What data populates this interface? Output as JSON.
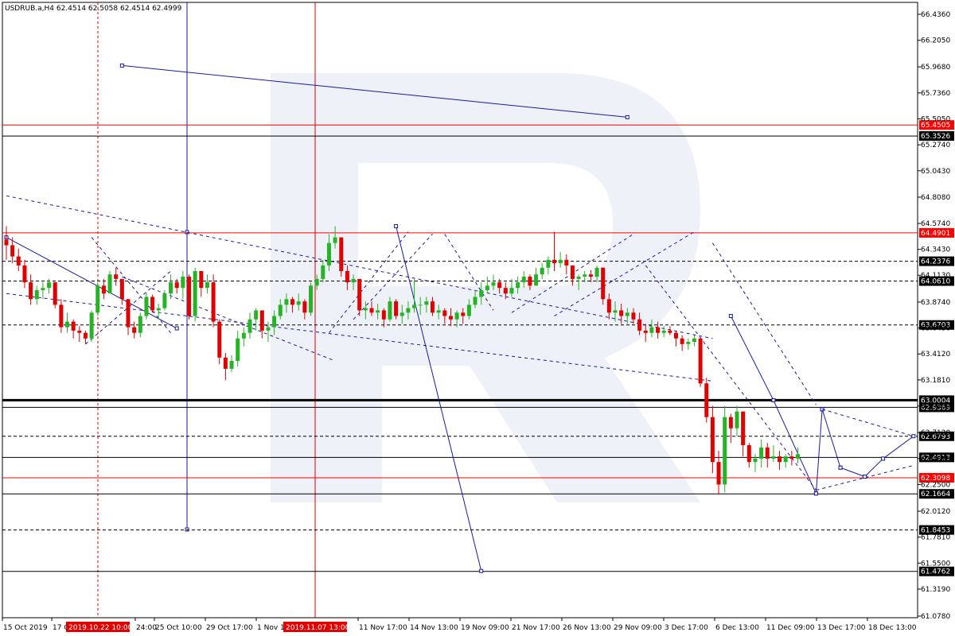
{
  "header": {
    "text": "USDRUB.a,H4  62.4514 62.5058 62.4514 62.4999"
  },
  "chart_data": {
    "type": "candlestick",
    "symbol": "USDRUB.a",
    "timeframe": "H4",
    "ohlc_header": {
      "open": 62.4514,
      "high": 62.5058,
      "low": 62.4514,
      "close": 62.4999
    },
    "ylim": [
      61.078,
      66.436
    ],
    "y_ticks": [
      "66.4360",
      "66.2050",
      "65.9680",
      "65.7360",
      "65.5050",
      "65.2740",
      "65.0430",
      "64.8080",
      "64.5740",
      "64.3430",
      "64.1130",
      "63.8740",
      "63.6430",
      "63.4120",
      "63.1810",
      "62.9480",
      "62.7120",
      "62.4810",
      "62.2500",
      "62.0120",
      "61.7810",
      "61.5500",
      "61.3190",
      "61.0780"
    ],
    "x_ticks": [
      "15 Oct 2019",
      "17 O",
      "24:00",
      "25 Oct 10:00",
      "29 Oct 17:00",
      "1 Nov 1",
      "11 Nov 17:00",
      "14 Nov 13:00",
      "19 Nov 09:00",
      "21 Nov 17:00",
      "26 Nov 13:00",
      "29 Nov 09:00",
      "3 Dec 17:00",
      "6 Dec 13:00",
      "11 Dec 09:00",
      "13 Dec 17:00",
      "18 Dec 13:00"
    ],
    "time_highlights": [
      "2019.10.22 10:00",
      "2019.11.07 13:00"
    ],
    "price_levels": [
      {
        "value": 65.4505,
        "label": "65.4505",
        "style": "solid",
        "color": "#ff0000",
        "highlight": true
      },
      {
        "value": 65.3526,
        "label": "65.3526",
        "style": "solid",
        "color": "#000000",
        "highlight": false
      },
      {
        "value": 64.4901,
        "label": "64.4901",
        "style": "solid",
        "color": "#ff0000",
        "highlight": true
      },
      {
        "value": 64.2376,
        "label": "64.2376",
        "style": "dashed",
        "color": "#000000",
        "highlight": false
      },
      {
        "value": 64.061,
        "label": "64.0610",
        "style": "dashed",
        "color": "#000000",
        "highlight": false
      },
      {
        "value": 63.6703,
        "label": "63.6703",
        "style": "dashed",
        "color": "#000000",
        "highlight": false
      },
      {
        "value": 63.0004,
        "label": "63.0004",
        "style": "thick",
        "color": "#000000",
        "highlight": false
      },
      {
        "value": 62.9369,
        "label": "62.9369",
        "style": "solid",
        "color": "#000000",
        "highlight": false
      },
      {
        "value": 62.6793,
        "label": "62.6793",
        "style": "dashed",
        "color": "#000000",
        "highlight": false
      },
      {
        "value": 62.4913,
        "label": "62.4913",
        "style": "solid",
        "color": "#000000",
        "highlight": false
      },
      {
        "value": 62.3098,
        "label": "62.3098",
        "style": "solid",
        "color": "#ff0000",
        "highlight": true
      },
      {
        "value": 62.1664,
        "label": "62.1664",
        "style": "solid",
        "color": "#000000",
        "highlight": false
      },
      {
        "value": 61.8453,
        "label": "61.8453",
        "style": "dashed",
        "color": "#000000",
        "highlight": false
      },
      {
        "value": 61.4762,
        "label": "61.4762",
        "style": "solid",
        "color": "#000000",
        "highlight": false
      }
    ],
    "candles_hlc": [
      [
        64.55,
        64.25,
        64.38
      ],
      [
        64.45,
        64.22,
        64.28
      ],
      [
        64.35,
        64.15,
        64.2
      ],
      [
        64.25,
        64.0,
        64.05
      ],
      [
        64.12,
        63.85,
        63.9
      ],
      [
        64.02,
        63.85,
        63.98
      ],
      [
        64.05,
        63.9,
        64.0
      ],
      [
        64.08,
        63.95,
        64.05
      ],
      [
        64.0,
        63.82,
        63.85
      ],
      [
        63.9,
        63.6,
        63.65
      ],
      [
        63.78,
        63.6,
        63.7
      ],
      [
        63.72,
        63.55,
        63.62
      ],
      [
        63.66,
        63.52,
        63.6
      ],
      [
        63.62,
        63.5,
        63.55
      ],
      [
        63.8,
        63.52,
        63.78
      ],
      [
        64.05,
        63.75,
        64.02
      ],
      [
        64.08,
        63.9,
        63.95
      ],
      [
        64.15,
        63.95,
        64.12
      ],
      [
        64.18,
        64.02,
        64.08
      ],
      [
        64.05,
        63.85,
        63.9
      ],
      [
        63.9,
        63.58,
        63.65
      ],
      [
        63.7,
        63.55,
        63.6
      ],
      [
        63.78,
        63.56,
        63.75
      ],
      [
        63.96,
        63.72,
        63.92
      ],
      [
        63.94,
        63.78,
        63.8
      ],
      [
        63.86,
        63.72,
        63.82
      ],
      [
        63.98,
        63.8,
        63.95
      ],
      [
        64.12,
        63.9,
        64.05
      ],
      [
        64.08,
        63.95,
        64.0
      ],
      [
        64.15,
        63.9,
        64.1
      ],
      [
        64.12,
        63.72,
        63.75
      ],
      [
        64.18,
        63.7,
        64.15
      ],
      [
        64.15,
        63.92,
        64.0
      ],
      [
        64.12,
        63.95,
        64.05
      ],
      [
        64.12,
        63.65,
        63.7
      ],
      [
        63.72,
        63.32,
        63.38
      ],
      [
        63.42,
        63.18,
        63.28
      ],
      [
        63.4,
        63.25,
        63.35
      ],
      [
        63.62,
        63.3,
        63.55
      ],
      [
        63.65,
        63.48,
        63.6
      ],
      [
        63.78,
        63.55,
        63.72
      ],
      [
        63.82,
        63.62,
        63.8
      ],
      [
        63.75,
        63.55,
        63.62
      ],
      [
        63.7,
        63.52,
        63.65
      ],
      [
        63.8,
        63.58,
        63.75
      ],
      [
        63.9,
        63.72,
        63.85
      ],
      [
        63.95,
        63.78,
        63.9
      ],
      [
        63.92,
        63.78,
        63.85
      ],
      [
        63.95,
        63.8,
        63.88
      ],
      [
        63.9,
        63.72,
        63.78
      ],
      [
        64.05,
        63.75,
        64.02
      ],
      [
        64.12,
        63.98,
        64.08
      ],
      [
        64.25,
        64.05,
        64.2
      ],
      [
        64.48,
        64.15,
        64.4
      ],
      [
        64.55,
        64.35,
        64.45
      ],
      [
        64.42,
        64.1,
        64.15
      ],
      [
        64.2,
        63.98,
        64.05
      ],
      [
        64.12,
        63.98,
        64.08
      ],
      [
        64.05,
        63.75,
        63.8
      ],
      [
        63.88,
        63.72,
        63.82
      ],
      [
        63.88,
        63.75,
        63.78
      ],
      [
        63.86,
        63.72,
        63.8
      ],
      [
        63.82,
        63.65,
        63.72
      ],
      [
        63.92,
        63.7,
        63.88
      ],
      [
        63.9,
        63.72,
        63.75
      ],
      [
        63.85,
        63.68,
        63.78
      ],
      [
        63.88,
        63.72,
        63.82
      ],
      [
        64.08,
        63.78,
        63.85
      ],
      [
        63.92,
        63.76,
        63.85
      ],
      [
        63.92,
        63.78,
        63.88
      ],
      [
        63.92,
        63.75,
        63.78
      ],
      [
        63.85,
        63.72,
        63.8
      ],
      [
        63.82,
        63.68,
        63.75
      ],
      [
        63.82,
        63.66,
        63.72
      ],
      [
        63.8,
        63.65,
        63.78
      ],
      [
        63.82,
        63.68,
        63.75
      ],
      [
        63.9,
        63.72,
        63.85
      ],
      [
        63.98,
        63.82,
        63.92
      ],
      [
        64.05,
        63.85,
        63.98
      ],
      [
        64.1,
        63.95,
        64.02
      ],
      [
        64.12,
        63.98,
        64.05
      ],
      [
        64.08,
        63.95,
        64.0
      ],
      [
        64.05,
        63.9,
        63.95
      ],
      [
        64.08,
        63.92,
        64.0
      ],
      [
        64.1,
        63.95,
        64.05
      ],
      [
        64.15,
        64.0,
        64.1
      ],
      [
        64.12,
        63.98,
        64.02
      ],
      [
        64.18,
        64.02,
        64.12
      ],
      [
        64.22,
        64.08,
        64.18
      ],
      [
        64.28,
        64.12,
        64.25
      ],
      [
        64.5,
        64.15,
        64.22
      ],
      [
        64.32,
        64.18,
        64.25
      ],
      [
        64.3,
        64.12,
        64.2
      ],
      [
        64.2,
        64.02,
        64.08
      ],
      [
        64.12,
        63.98,
        64.1
      ],
      [
        64.15,
        64.05,
        64.12
      ],
      [
        64.16,
        64.05,
        64.1
      ],
      [
        64.2,
        64.05,
        64.18
      ],
      [
        64.18,
        63.85,
        63.9
      ],
      [
        63.95,
        63.72,
        63.78
      ],
      [
        63.88,
        63.7,
        63.8
      ],
      [
        63.86,
        63.68,
        63.75
      ],
      [
        63.82,
        63.68,
        63.78
      ],
      [
        63.82,
        63.68,
        63.72
      ],
      [
        63.78,
        63.58,
        63.62
      ],
      [
        63.68,
        63.52,
        63.6
      ],
      [
        63.72,
        63.56,
        63.65
      ],
      [
        63.7,
        63.55,
        63.6
      ],
      [
        63.66,
        63.56,
        63.62
      ],
      [
        63.66,
        63.58,
        63.6
      ],
      [
        63.62,
        63.48,
        63.55
      ],
      [
        63.58,
        63.44,
        63.5
      ],
      [
        63.55,
        63.45,
        63.52
      ],
      [
        63.58,
        63.48,
        63.55
      ],
      [
        63.3,
        63.12,
        63.15
      ],
      [
        63.2,
        62.8,
        62.85
      ],
      [
        62.95,
        62.35,
        62.45
      ],
      [
        62.55,
        62.16,
        62.25
      ],
      [
        62.95,
        62.18,
        62.85
      ],
      [
        62.88,
        62.62,
        62.75
      ],
      [
        62.95,
        62.68,
        62.9
      ],
      [
        62.88,
        62.5,
        62.6
      ],
      [
        62.62,
        62.4,
        62.45
      ],
      [
        62.52,
        62.36,
        62.48
      ],
      [
        62.65,
        62.4,
        62.58
      ],
      [
        62.62,
        62.4,
        62.48
      ],
      [
        62.6,
        62.45,
        62.5
      ],
      [
        62.55,
        62.38,
        62.45
      ],
      [
        62.52,
        62.4,
        62.5
      ],
      [
        62.55,
        62.42,
        62.48
      ],
      [
        62.58,
        62.44,
        62.52
      ]
    ],
    "trend_lines": [
      {
        "points": [
          [
            0,
            64.82
          ],
          [
            116,
            63.55
          ]
        ],
        "style": "dashed"
      },
      {
        "points": [
          [
            0,
            63.95
          ],
          [
            116,
            63.17
          ]
        ],
        "style": "dashed"
      },
      {
        "points": [
          [
            0,
            64.45
          ],
          [
            28,
            63.64
          ]
        ],
        "style": "solid"
      },
      {
        "points": [
          [
            19,
            65.98
          ],
          [
            102,
            65.52
          ]
        ],
        "style": "solid"
      },
      {
        "points": [
          [
            14,
            64.45
          ],
          [
            27,
            63.6
          ]
        ],
        "style": "dashed"
      },
      {
        "points": [
          [
            13,
            63.5
          ],
          [
            27,
            64.15
          ]
        ],
        "style": "dashed"
      },
      {
        "points": [
          [
            19,
            64.1
          ],
          [
            54,
            63.35
          ]
        ],
        "style": "dashed"
      },
      {
        "points": [
          [
            53,
            63.6
          ],
          [
            66,
            64.5
          ]
        ],
        "style": "dashed"
      },
      {
        "points": [
          [
            57,
            63.72
          ],
          [
            70,
            64.48
          ]
        ],
        "style": "dashed"
      },
      {
        "points": [
          [
            64,
            64.55
          ],
          [
            78,
            61.48
          ]
        ],
        "style": "solid"
      },
      {
        "points": [
          [
            72,
            64.48
          ],
          [
            80,
            63.8
          ]
        ],
        "style": "dashed"
      },
      {
        "points": [
          [
            83,
            63.78
          ],
          [
            103,
            64.48
          ]
        ],
        "style": "dashed"
      },
      {
        "points": [
          [
            90,
            63.75
          ],
          [
            113,
            64.5
          ]
        ],
        "style": "dashed"
      },
      {
        "points": [
          [
            105,
            64.2
          ],
          [
            133,
            62.2
          ]
        ],
        "style": "dashed"
      },
      {
        "points": [
          [
            116,
            64.4
          ],
          [
            133,
            62.96
          ]
        ],
        "style": "dashed"
      },
      {
        "points": [
          [
            119,
            63.75
          ],
          [
            126,
            63.0
          ]
        ],
        "style": "solid"
      },
      {
        "points": [
          [
            126,
            63.0
          ],
          [
            133,
            62.17
          ]
        ],
        "style": "solid"
      },
      {
        "points": [
          [
            133,
            62.17
          ],
          [
            134,
            62.92
          ]
        ],
        "style": "solid"
      },
      {
        "points": [
          [
            134,
            62.92
          ],
          [
            137,
            62.4
          ]
        ],
        "style": "solid"
      },
      {
        "points": [
          [
            134,
            62.92
          ],
          [
            149,
            62.68
          ]
        ],
        "style": "dashed"
      },
      {
        "points": [
          [
            133,
            62.2
          ],
          [
            149,
            62.42
          ]
        ],
        "style": "dashed"
      },
      {
        "points": [
          [
            137,
            62.4
          ],
          [
            141,
            62.32
          ]
        ],
        "style": "solid"
      },
      {
        "points": [
          [
            141,
            62.32
          ],
          [
            144,
            62.48
          ]
        ],
        "style": "solid"
      },
      {
        "points": [
          [
            144,
            62.48
          ],
          [
            149,
            62.68
          ]
        ],
        "style": "solid"
      }
    ]
  }
}
